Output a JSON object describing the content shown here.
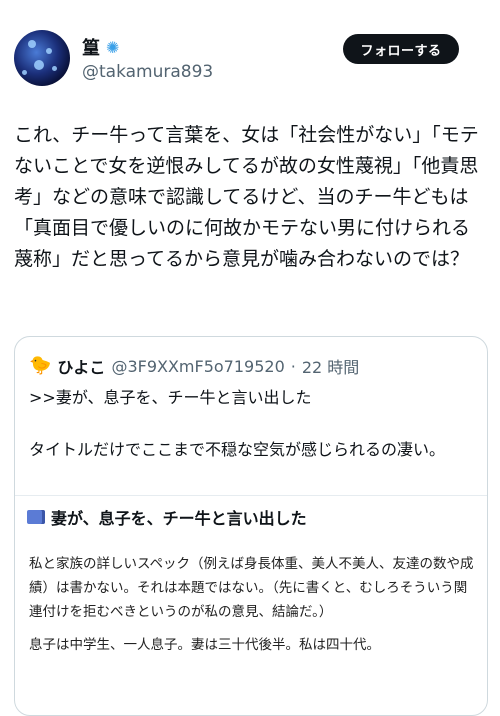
{
  "author": {
    "display_name": "篁",
    "badge_icon": "jellyfish-icon",
    "handle": "@takamura893",
    "avatar_icon": "jellyfish-avatar"
  },
  "actions": {
    "follow_label": "フォローする"
  },
  "tweet": {
    "text": "これ、チー牛って言葉を、女は「社会性がない」「モテないことで女を逆恨みしてるが故の女性蔑視」「他責思考」などの意味で認識してるけど、当のチー牛どもは「真面目で優しいのに何故かモテない男に付けられる蔑称」だと思ってるから意見が噛み合わないのでは？"
  },
  "quote": {
    "icon": "chick-icon",
    "name": "ひよこ",
    "handle": "@3F9XXmF5o719520",
    "separator": "·",
    "time": "22 時間",
    "text": ">>妻が、息子を、チー牛と言い出した\n\nタイトルだけでここまで不穏な空気が感じられるの凄い。",
    "card": {
      "title_icon": "book-icon",
      "title": "妻が、息子を、チー牛と言い出した",
      "paragraphs": [
        "私と家族の詳しいスペック（例えば身長体重、美人不美人、友達の数や成績）は書かない。それは本題ではない。（先に書くと、むしろそういう関連付けを拒むべきというのが私の意見、結論だ。）",
        "息子は中学生、一人息子。妻は三十代後半。私は四十代。"
      ]
    }
  }
}
